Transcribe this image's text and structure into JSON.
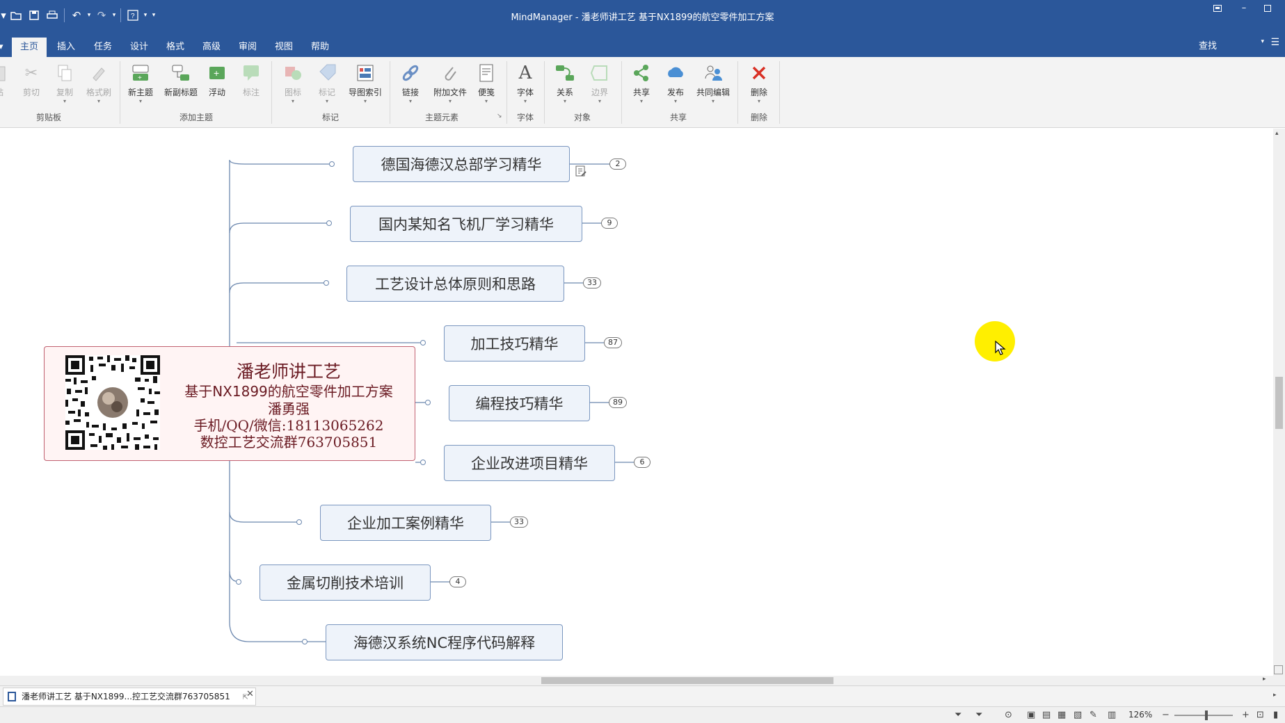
{
  "window": {
    "title": "MindManager - 潘老师讲工艺 基于NX1899的航空零件加工方案"
  },
  "tabs": [
    {
      "label": "主页",
      "active": true
    },
    {
      "label": "插入"
    },
    {
      "label": "任务"
    },
    {
      "label": "设计"
    },
    {
      "label": "格式"
    },
    {
      "label": "高级"
    },
    {
      "label": "审阅"
    },
    {
      "label": "视图"
    },
    {
      "label": "帮助"
    }
  ],
  "find_label": "查找",
  "ribbon": {
    "paste": "贴",
    "cut": "剪切",
    "copy": "复制",
    "format_painter": "格式刷",
    "new_topic": "新主题",
    "new_subtopic": "新副标题",
    "floating": "浮动",
    "callout": "标注",
    "icons": "图标",
    "tags": "标记",
    "map_index": "导图索引",
    "link": "链接",
    "attach_file": "附加文件",
    "notes": "便笺",
    "font": "字体",
    "relationship": "关系",
    "boundary": "边界",
    "share": "共享",
    "publish": "发布",
    "co_edit": "共同编辑",
    "delete": "删除",
    "groups": {
      "clipboard": "剪贴板",
      "add_topic": "添加主题",
      "markers": "标记",
      "topic_elements": "主题元素",
      "font": "字体",
      "objects": "对象",
      "share": "共享",
      "delete": "删除"
    }
  },
  "central_topic": {
    "line1": "潘老师讲工艺",
    "line2": "基于NX1899的航空零件加工方案",
    "line3": "潘勇强",
    "line4": "手机/QQ/微信:18113065262",
    "line5": "数控工艺交流群763705851"
  },
  "topics": [
    {
      "label": "德国海德汉总部学习精华",
      "count": "2",
      "has_note": true
    },
    {
      "label": "国内某知名飞机厂学习精华",
      "count": "9"
    },
    {
      "label": "工艺设计总体原则和思路",
      "count": "33"
    },
    {
      "label": "加工技巧精华",
      "count": "87"
    },
    {
      "label": "编程技巧精华",
      "count": "89"
    },
    {
      "label": "企业改进项目精华",
      "count": "6"
    },
    {
      "label": "企业加工案例精华",
      "count": "33"
    },
    {
      "label": "金属切削技术培训",
      "count": "4"
    },
    {
      "label": "海德汉系统NC程序代码解释",
      "count": ""
    }
  ],
  "doc_tab": {
    "label": "潘老师讲工艺 基于NX1899...控工艺交流群763705851"
  },
  "status": {
    "zoom": "126%"
  },
  "colors": {
    "titlebar": "#2b579a",
    "topic_fill": "#eef3fa",
    "topic_border": "#7a96bf",
    "central_border": "#c06070",
    "central_text": "#6a1a22",
    "cursor_highlight": "#ffef00"
  },
  "icons": [
    "open-icon",
    "save-icon",
    "print-icon",
    "undo-icon",
    "redo-icon",
    "help-icon",
    "note-icon",
    "filter-icon",
    "mouse-cursor-icon"
  ]
}
